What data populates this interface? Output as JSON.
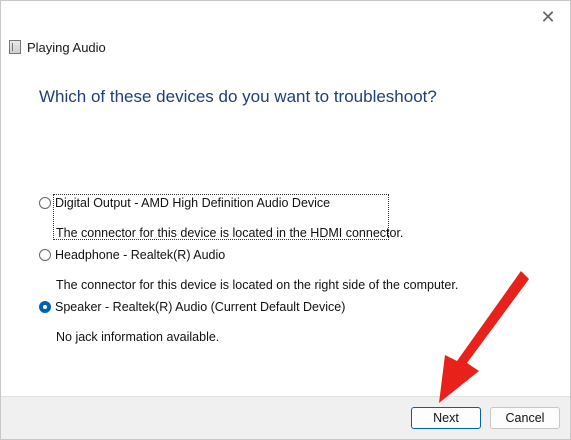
{
  "window": {
    "app_title": "Playing Audio",
    "app_icon": "audio-troubleshooter-icon",
    "close_glyph": "✕"
  },
  "main": {
    "heading": "Which of these devices do you want to troubleshoot?",
    "options": [
      {
        "label": "Digital Output - AMD High Definition Audio Device",
        "description": "The connector for this device is located in the HDMI connector.",
        "checked": false
      },
      {
        "label": "Headphone - Realtek(R) Audio",
        "description": "The connector for this device is located on the right side of the computer.",
        "checked": false
      },
      {
        "label": "Speaker - Realtek(R) Audio (Current Default Device)",
        "description": "No jack information available.",
        "checked": true
      }
    ]
  },
  "footer": {
    "next_label": "Next",
    "cancel_label": "Cancel"
  },
  "colors": {
    "heading": "#1f3f77",
    "accent": "#005fb8",
    "annotation_arrow": "#e8211a"
  }
}
